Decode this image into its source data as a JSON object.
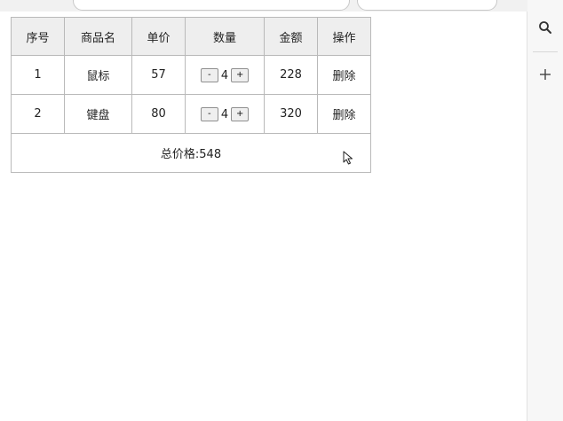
{
  "table": {
    "headers": [
      "序号",
      "商品名",
      "单价",
      "数量",
      "金额",
      "操作"
    ],
    "rows": [
      {
        "index": "1",
        "name": "鼠标",
        "price": "57",
        "qty": "4",
        "amount": "228",
        "action": "删除"
      },
      {
        "index": "2",
        "name": "键盘",
        "price": "80",
        "qty": "4",
        "amount": "320",
        "action": "删除"
      }
    ],
    "decrement_label": "-",
    "increment_label": "+",
    "total_label": "总价格:548"
  },
  "sidebar": {
    "icons": [
      "search-icon",
      "plus-icon"
    ]
  },
  "colors": {
    "header_bg": "#eeeeee",
    "border": "#b9b9b9",
    "sidebar_bg": "#f7f7f7"
  }
}
